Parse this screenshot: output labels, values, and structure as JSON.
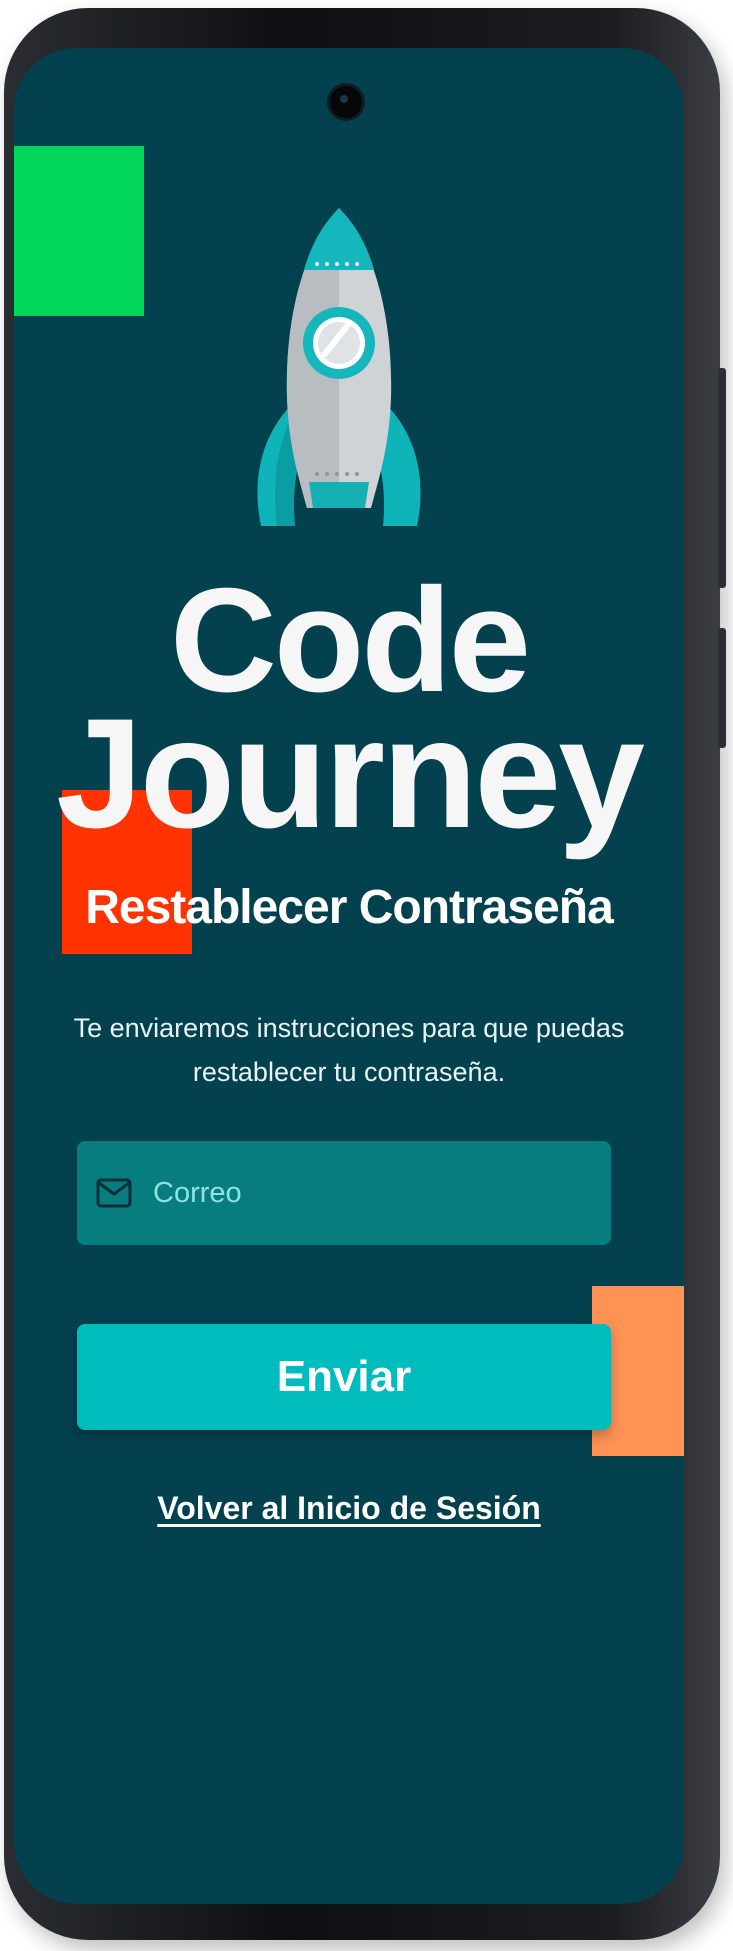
{
  "brand": {
    "line1": "Code",
    "line2": "Journey"
  },
  "page": {
    "title": "Restablecer Contraseña",
    "subtitle": "Te enviaremos instrucciones para que puedas restablecer tu contraseña."
  },
  "form": {
    "email_placeholder": "Correo",
    "email_value": "",
    "submit_label": "Enviar"
  },
  "links": {
    "back_to_login": "Volver al Inicio de Sesión"
  },
  "colors": {
    "background": "#04414f",
    "input": "#087d80",
    "accent": "#00bcbc",
    "deco_green": "#00d65a",
    "deco_red": "#ff3200",
    "deco_orange": "#ff9255"
  },
  "icons": {
    "logo": "rocket-icon",
    "email": "mail-icon"
  }
}
